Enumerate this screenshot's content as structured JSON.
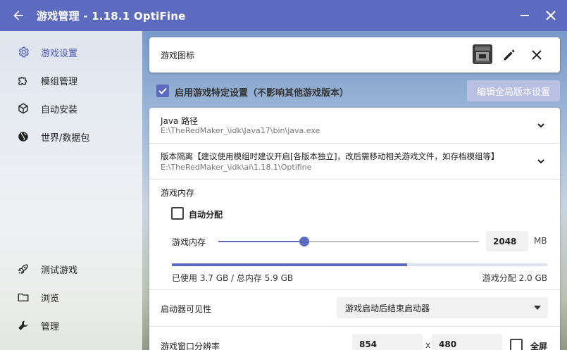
{
  "window": {
    "title": "游戏管理 - 1.18.1 OptiFine",
    "back_icon": "arrow-left-icon",
    "minimize_icon": "minimize-icon",
    "close_icon": "close-icon"
  },
  "sidebar": {
    "top_items": [
      {
        "label": "游戏设置",
        "icon": "gear-icon",
        "active": true
      },
      {
        "label": "模组管理",
        "icon": "puzzle-icon",
        "active": false
      },
      {
        "label": "自动安装",
        "icon": "package-icon",
        "active": false
      },
      {
        "label": "世界/数据包",
        "icon": "globe-icon",
        "active": false
      }
    ],
    "bottom_items": [
      {
        "label": "测试游戏",
        "icon": "rocket-icon"
      },
      {
        "label": "浏览",
        "icon": "folder-icon"
      },
      {
        "label": "管理",
        "icon": "wrench-icon"
      }
    ]
  },
  "icon_card": {
    "label": "游戏图标",
    "icon": "command-block-icon",
    "edit_icon": "pencil-icon",
    "clear_icon": "close-icon"
  },
  "specific_settings": {
    "checkbox_label": "启用游戏特定设置（不影响其他游戏版本）",
    "checked": true,
    "edit_global_button": "编辑全局版本设置"
  },
  "settings": {
    "java": {
      "label": "Java 路径",
      "value": "E:\\TheRedMaker_\\idk\\Java17\\bin\\java.exe"
    },
    "isolation": {
      "label": "版本隔离【建议使用模组时建议开启[各版本独立]，改后需移动相关游戏文件，如存档模组等】",
      "value": "E:\\TheRedMaker_\\idk\\ai\\1.18.1\\Optifine"
    },
    "memory": {
      "section_label": "游戏内存",
      "auto_label": "自动分配",
      "auto_checked": false,
      "slider_label": "游戏内存",
      "value": "2048",
      "unit": "MB",
      "slider_fraction": 0.33,
      "usage_fraction": 0.627,
      "used_text": "已使用 3.7 GB / 总内存 5.9 GB",
      "allocated_text": "游戏分配 2.0 GB"
    },
    "launcher_visibility": {
      "label": "启动器可见性",
      "selected": "游戏启动后结束启动器"
    },
    "resolution": {
      "label": "游戏窗口分辨率",
      "width": "854",
      "separator": "x",
      "height": "480",
      "fullscreen_label": "全屏",
      "fullscreen_checked": false
    }
  }
}
